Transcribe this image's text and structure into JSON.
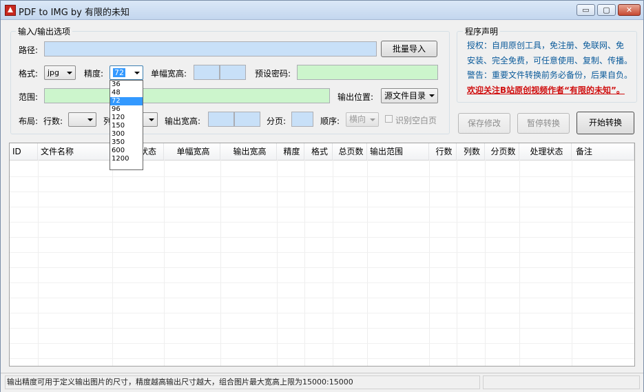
{
  "window": {
    "title": "PDF to IMG  by 有限的未知",
    "minimize": "▭",
    "maximize": "▢",
    "close": "✕"
  },
  "options": {
    "group_title": "输入/输出选项",
    "path_label": "路径:",
    "batch_import": "批量导入",
    "format_label": "格式:",
    "format_value": "jpg",
    "precision_label": "精度:",
    "precision_value": "72",
    "single_size_label": "单幅宽高:",
    "password_label": "预设密码:",
    "range_label": "范围:",
    "output_location_label": "输出位置:",
    "output_location_value": "源文件目录",
    "layout_label": "布局:",
    "rows_label": "行数:",
    "cols_label": "列",
    "output_size_label": "输出宽高:",
    "paging_label": "分页:",
    "order_label": "顺序:",
    "order_value": "横向",
    "blank_page_label": "识别空白页"
  },
  "precision_options": [
    "36",
    "48",
    "72",
    "96",
    "120",
    "150",
    "300",
    "350",
    "600",
    "1200"
  ],
  "precision_selected_index": 2,
  "declaration": {
    "title": "程序声明",
    "line1": "授权：自用原创工具，免注册、免联网、免",
    "line2": "安装、完全免费，可任意使用、复制、传播。",
    "line3": "警告：重要文件转换前务必备份，后果自负。",
    "line4": "欢迎关注B站原创视频作者“有限的未知”。"
  },
  "actions": {
    "save": "保存修改",
    "pause": "暂停转换",
    "start": "开始转换"
  },
  "table": {
    "columns": [
      "ID",
      "文件名称",
      "状态",
      "单幅宽高",
      "输出宽高",
      "精度",
      "格式",
      "总页数",
      "输出范围",
      "行数",
      "列数",
      "分页数",
      "处理状态",
      "备注"
    ]
  },
  "status": {
    "message": "输出精度可用于定义输出图片的尺寸，精度越高输出尺寸越大，组合图片最大宽高上限为15000:15000"
  },
  "colors": {
    "path_field": "#c8e0f8",
    "password_field": "#ccf5cc",
    "declaration_text": "#0a5a9a",
    "declaration_highlight": "#d01010",
    "selection": "#3399ff"
  }
}
